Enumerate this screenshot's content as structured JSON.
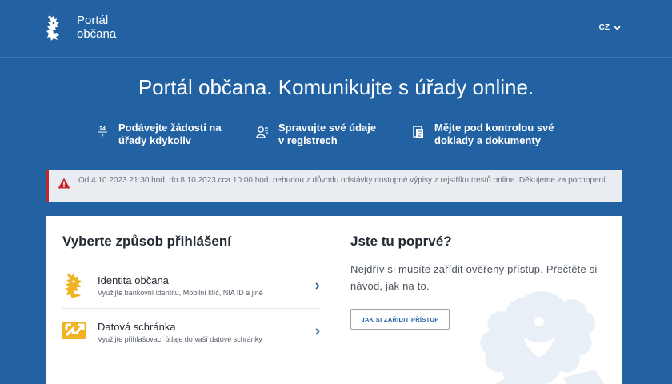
{
  "header": {
    "logo_line1": "Portál",
    "logo_line2": "občana",
    "language": "CZ"
  },
  "hero": {
    "title": "Portál občana. Komunikujte s úřady online."
  },
  "features": [
    {
      "icon": "calendar-24-7-icon",
      "text": "Podávejte žádosti na\núřady kdykoliv"
    },
    {
      "icon": "user-list-icon",
      "text": "Spravujte své údaje\nv registrech"
    },
    {
      "icon": "documents-icon",
      "text": "Mějte pod kontrolou své\ndoklady a dokumenty"
    }
  ],
  "alert": {
    "icon": "warning-icon",
    "color": "#c5262e",
    "text": "Od 4.10.2023 21:30 hod. do 8.10.2023 cca 10:00 hod. nebudou z důvodu odstávky dostupné výpisy z rejstříku trestů online. Děkujeme za pochopení."
  },
  "login": {
    "title": "Vyberte způsob přihlášení",
    "methods": [
      {
        "icon": "lion-icon",
        "title": "Identita občana",
        "subtitle": "Využijte bankovní identitu, Mobilní klíč, NIA ID a jiné"
      },
      {
        "icon": "data-box-icon",
        "title": "Datová schránka",
        "subtitle": "Využijte přihlašovací údaje do vaší datové schránky"
      }
    ]
  },
  "first_time": {
    "title": "Jste tu poprvé?",
    "text": "Nejdřív si musíte zařídit ověřený přístup. Přečtěte si návod, jak na to.",
    "button": "JAK SI ZAŘÍDIT PŘÍSTUP"
  },
  "colors": {
    "background": "#2362a2",
    "accent_gold": "#f0b323",
    "alert_red": "#c5262e"
  }
}
